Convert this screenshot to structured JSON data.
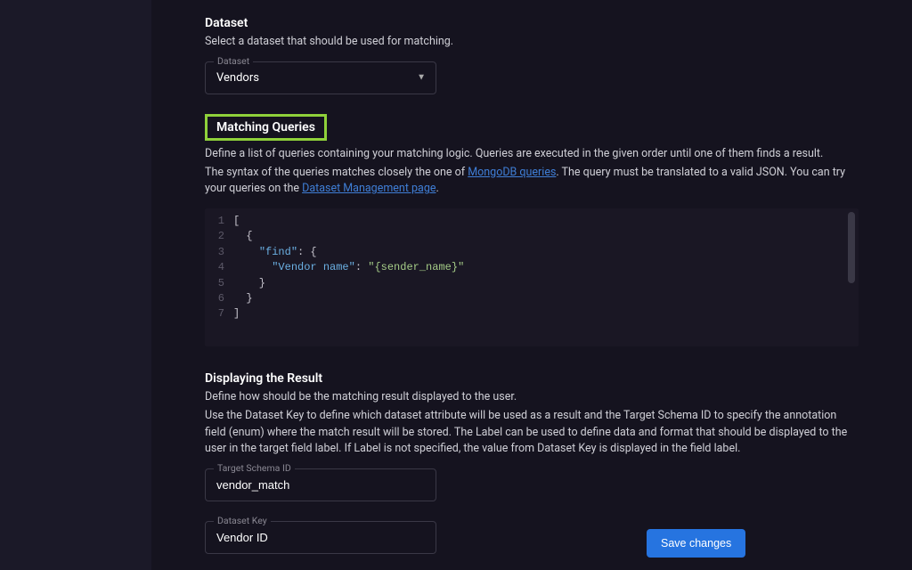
{
  "sections": {
    "dataset": {
      "title": "Dataset",
      "desc": "Select a dataset that should be used for matching.",
      "field_label": "Dataset",
      "field_value": "Vendors"
    },
    "matching": {
      "title": "Matching Queries",
      "desc_pre": "Define a list of queries containing your matching logic. Queries are executed in the given order until one of them finds a result.",
      "desc_line2_a": "The syntax of the queries matches closely the one of ",
      "link1": "MongoDB queries",
      "desc_line2_b": ". The query must be translated to a valid JSON. You can try your queries on the ",
      "link2": "Dataset Management page",
      "desc_line2_c": ".",
      "code": {
        "lines": [
          "1",
          "2",
          "3",
          "4",
          "5",
          "6",
          "7"
        ],
        "l1": "[",
        "l2": "  {",
        "l3_a": "    ",
        "l3_key": "\"find\"",
        "l3_b": ": {",
        "l4_a": "      ",
        "l4_key": "\"Vendor name\"",
        "l4_b": ": ",
        "l4_val": "\"{sender_name}\"",
        "l5": "    }",
        "l6": "  }",
        "l7": "]"
      }
    },
    "result": {
      "title": "Displaying the Result",
      "desc1": "Define how should be the matching result displayed to the user.",
      "desc2": "Use the Dataset Key to define which dataset attribute will be used as a result and the Target Schema ID to specify the annotation field (enum) where the match result will be stored. The Label can be used to define data and format that should be displayed to the user in the target field label. If Label is not specified, the value from Dataset Key is displayed in the field label.",
      "target_schema_label": "Target Schema ID",
      "target_schema_value": "vendor_match",
      "dataset_key_label": "Dataset Key",
      "dataset_key_value": "Vendor ID"
    }
  },
  "actions": {
    "save": "Save changes"
  }
}
